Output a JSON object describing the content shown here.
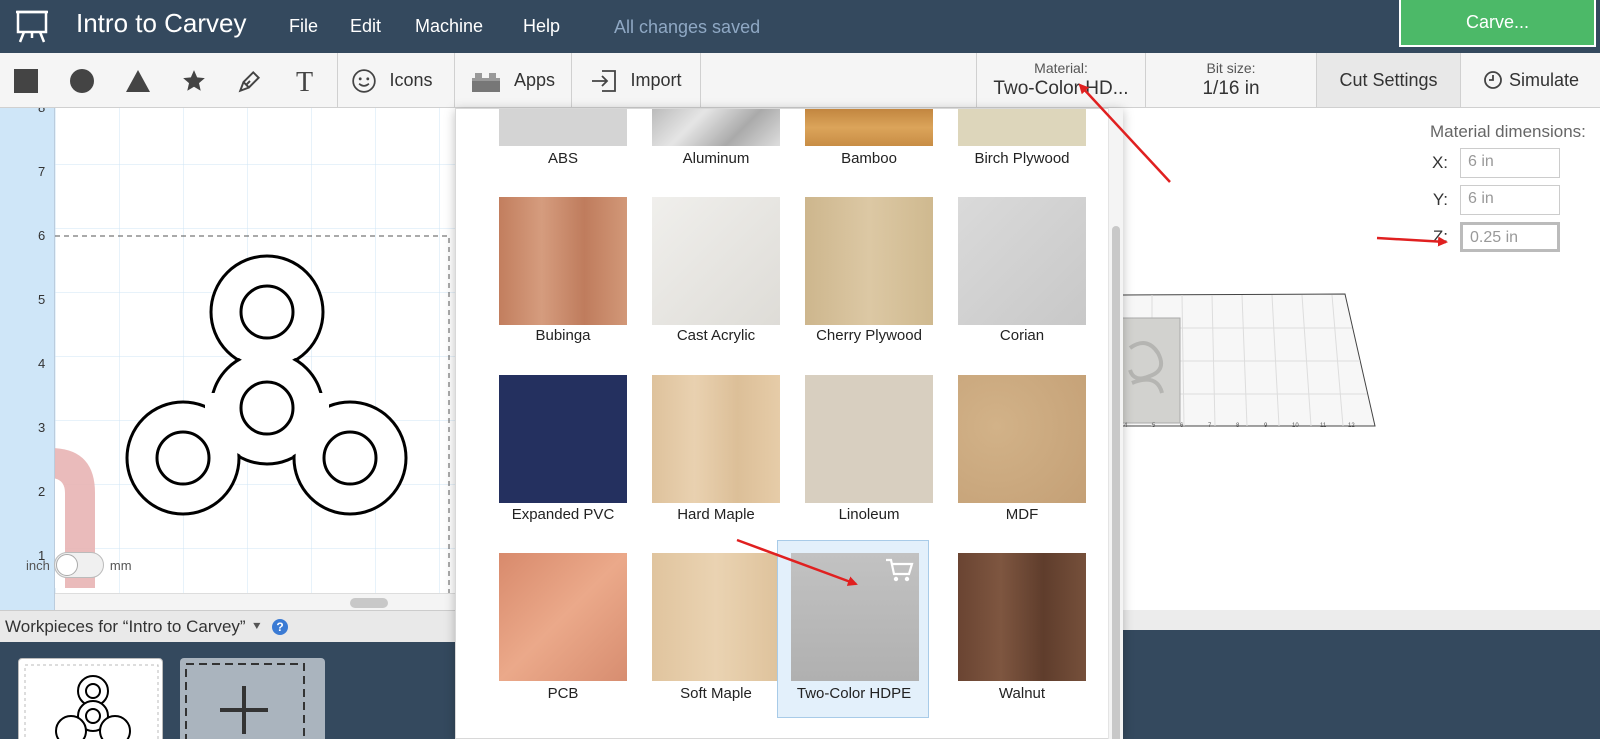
{
  "app": {
    "title": "Intro to Carvey",
    "menu": [
      "File",
      "Edit",
      "Machine",
      "Help"
    ],
    "save_status": "All changes saved",
    "carve_label": "Carve..."
  },
  "toolbar": {
    "icons_label": "Icons",
    "apps_label": "Apps",
    "import_label": "Import",
    "material_label": "Material:",
    "material_value": "Two-Color HD...",
    "bit_label": "Bit size:",
    "bit_value": "1/16 in",
    "cut_settings_label": "Cut Settings",
    "simulate_label": "Simulate"
  },
  "canvas": {
    "ruler_ticks": [
      "8",
      "7",
      "6",
      "5",
      "4",
      "3",
      "2",
      "1"
    ],
    "unit_left": "inch",
    "unit_right": "mm"
  },
  "workpieces": {
    "header": "Workpieces for “Intro to Carvey”",
    "help_icon_text": "?"
  },
  "material_dimensions": {
    "heading": "Material dimensions:",
    "x_label": "X:",
    "x_value": "6 in",
    "y_label": "Y:",
    "y_value": "6 in",
    "z_label": "Z:",
    "z_value": "0.25 in"
  },
  "preview": {
    "axis_ticks": [
      "4",
      "5",
      "6",
      "7",
      "8",
      "9",
      "10",
      "11",
      "12"
    ]
  },
  "materials_top_row": [
    {
      "name": "ABS",
      "color": "#d4d4d4"
    },
    {
      "name": "Aluminum",
      "color": "#c8c8c8"
    },
    {
      "name": "Bamboo",
      "color": "#cf9a4e"
    },
    {
      "name": "Birch Plywood",
      "color": "#ddd6bb"
    }
  ],
  "materials": [
    {
      "name": "Bubinga",
      "color": "#c9896a"
    },
    {
      "name": "Cast Acrylic",
      "color": "#e8e6e2"
    },
    {
      "name": "Cherry Plywood",
      "color": "#d6c19c"
    },
    {
      "name": "Corian",
      "color": "#d3d3d3"
    },
    {
      "name": "Expanded PVC",
      "color": "#24305f"
    },
    {
      "name": "Hard Maple",
      "color": "#e4c9a4"
    },
    {
      "name": "Linoleum",
      "color": "#d8cfc0"
    },
    {
      "name": "MDF",
      "color": "#c9a87c"
    },
    {
      "name": "PCB",
      "color": "#e09a7c"
    },
    {
      "name": "Soft Maple",
      "color": "#e2c8a4"
    },
    {
      "name": "Two-Color HDPE",
      "color": "#b8b8b8"
    },
    {
      "name": "Walnut",
      "color": "#6e4a36"
    }
  ],
  "selected_material": "Two-Color HDPE",
  "colors": {
    "header_bg": "#34495e",
    "carve_green": "#4cb968",
    "ruler_blue": "#cfe6f8",
    "arrow_red": "#e02020",
    "selection_bg": "#e3f0fb"
  }
}
